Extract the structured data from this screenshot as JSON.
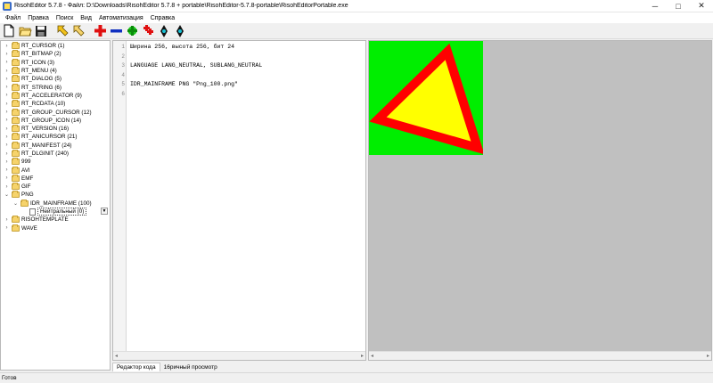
{
  "window": {
    "title": "RisohEditor 5.7.8 - Файл: D:\\Downloads\\RisohEditor 5.7.8 + portable\\RisohEditor-5.7.8-portable\\RisohEditorPortable.exe",
    "minimize": "─",
    "maximize": "□",
    "close": "✕"
  },
  "menu": [
    "Файл",
    "Правка",
    "Поиск",
    "Вид",
    "Автоматизация",
    "Справка"
  ],
  "toolbar_icons": [
    "new-file-icon",
    "open-folder-icon",
    "save-icon",
    "arrow-up-left-icon",
    "arrow-up-left-alt-icon",
    "add-icon",
    "remove-icon",
    "add-resource-icon",
    "copy-resource-icon",
    "test-icon",
    "test-alt-icon"
  ],
  "tree": [
    {
      "label": "RT_CURSOR (1)",
      "level": 0,
      "exp": "›",
      "icon": "folder"
    },
    {
      "label": "RT_BITMAP (2)",
      "level": 0,
      "exp": "›",
      "icon": "folder"
    },
    {
      "label": "RT_ICON (3)",
      "level": 0,
      "exp": "›",
      "icon": "folder"
    },
    {
      "label": "RT_MENU (4)",
      "level": 0,
      "exp": "›",
      "icon": "folder"
    },
    {
      "label": "RT_DIALOG (5)",
      "level": 0,
      "exp": "›",
      "icon": "folder"
    },
    {
      "label": "RT_STRING (6)",
      "level": 0,
      "exp": "›",
      "icon": "folder"
    },
    {
      "label": "RT_ACCELERATOR (9)",
      "level": 0,
      "exp": "›",
      "icon": "folder"
    },
    {
      "label": "RT_RCDATA (10)",
      "level": 0,
      "exp": "›",
      "icon": "folder"
    },
    {
      "label": "RT_GROUP_CURSOR (12)",
      "level": 0,
      "exp": "›",
      "icon": "folder"
    },
    {
      "label": "RT_GROUP_ICON (14)",
      "level": 0,
      "exp": "›",
      "icon": "folder"
    },
    {
      "label": "RT_VERSION (16)",
      "level": 0,
      "exp": "›",
      "icon": "folder"
    },
    {
      "label": "RT_ANICURSOR (21)",
      "level": 0,
      "exp": "›",
      "icon": "folder"
    },
    {
      "label": "RT_MANIFEST (24)",
      "level": 0,
      "exp": "›",
      "icon": "folder"
    },
    {
      "label": "RT_DLGINIT (240)",
      "level": 0,
      "exp": "›",
      "icon": "folder"
    },
    {
      "label": "999",
      "level": 0,
      "exp": "›",
      "icon": "folder"
    },
    {
      "label": "AVI",
      "level": 0,
      "exp": "›",
      "icon": "folder"
    },
    {
      "label": "EMF",
      "level": 0,
      "exp": "›",
      "icon": "folder"
    },
    {
      "label": "GIF",
      "level": 0,
      "exp": "›",
      "icon": "folder"
    },
    {
      "label": "PNG",
      "level": 0,
      "exp": "⌄",
      "icon": "folder"
    },
    {
      "label": "IDR_MAINFRAME (100)",
      "level": 1,
      "exp": "⌄",
      "icon": "folder"
    },
    {
      "label": "Нейтральный (0)",
      "level": 2,
      "exp": "",
      "icon": "file",
      "selected": true
    },
    {
      "label": "RISOHTEMPLATE",
      "level": 0,
      "exp": "›",
      "icon": "folder"
    },
    {
      "label": "WAVE",
      "level": 0,
      "exp": "›",
      "icon": "folder"
    }
  ],
  "code": {
    "lines": [
      {
        "num": "1",
        "text": "Ширина 256, высота 256, бит 24"
      },
      {
        "num": "2",
        "text": ""
      },
      {
        "num": "3",
        "text": "LANGUAGE LANG_NEUTRAL, SUBLANG_NEUTRAL"
      },
      {
        "num": "4",
        "text": ""
      },
      {
        "num": "5",
        "text": "IDR_MAINFRAME PNG \"Png_100.png\""
      },
      {
        "num": "6",
        "text": ""
      }
    ]
  },
  "tabs": [
    {
      "label": "Редактор кода",
      "active": true
    },
    {
      "label": "16ричный просмотр",
      "active": false
    }
  ],
  "scroll": {
    "left": "◂",
    "right": "▸"
  },
  "status": "Готов",
  "colors": {
    "image_bg": "#00ee00",
    "triangle_fill": "#ffff00",
    "triangle_border": "#ff0000",
    "preview_bg": "#c0c0c0"
  }
}
